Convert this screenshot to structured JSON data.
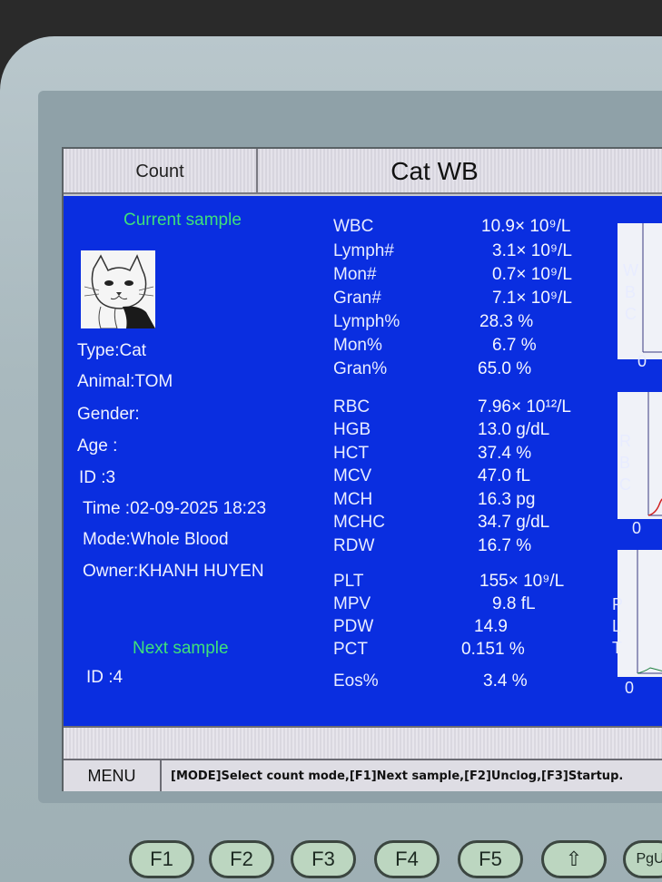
{
  "header": {
    "mode_label": "Count",
    "title": "Cat WB"
  },
  "current": {
    "heading": "Current sample",
    "type": "Type:Cat",
    "animal": "Animal:TOM",
    "gender": "Gender:",
    "age": "Age  :",
    "id": "ID    :3",
    "time": "Time :02-09-2025 18:23",
    "mode": "Mode:Whole Blood",
    "owner": "Owner:KHANH HUYEN"
  },
  "next": {
    "heading": "Next sample",
    "id": "ID    :4"
  },
  "parameters": [
    {
      "name": "WBC",
      "value": "10.9× 10⁹/L"
    },
    {
      "name": "Lymph#",
      "value": "3.1× 10⁹/L"
    },
    {
      "name": "Mon#",
      "value": "0.7× 10⁹/L"
    },
    {
      "name": "Gran#",
      "value": "7.1× 10⁹/L"
    },
    {
      "name": "Lymph%",
      "value": "28.3 %"
    },
    {
      "name": "Mon%",
      "value": "6.7 %"
    },
    {
      "name": "Gran%",
      "value": "65.0 %"
    },
    {
      "name": "RBC",
      "value": "7.96× 10¹²/L"
    },
    {
      "name": "HGB",
      "value": "13.0 g/dL"
    },
    {
      "name": "HCT",
      "value": "37.4 %"
    },
    {
      "name": "MCV",
      "value": "47.0 fL"
    },
    {
      "name": "MCH",
      "value": "16.3 pg"
    },
    {
      "name": "MCHC",
      "value": "34.7 g/dL"
    },
    {
      "name": "RDW",
      "value": "16.7 %"
    },
    {
      "name": "PLT",
      "value": "155× 10⁹/L"
    },
    {
      "name": "MPV",
      "value": "9.8 fL"
    },
    {
      "name": "PDW",
      "value": "14.9"
    },
    {
      "name": "PCT",
      "value": "0.151 %"
    },
    {
      "name": "Eos%",
      "value": "3.4 %"
    }
  ],
  "histograms": {
    "wbc": {
      "letters": [
        "W",
        "B",
        "C"
      ],
      "zero": "0"
    },
    "rbc": {
      "letters": [
        "R",
        "B",
        "C"
      ],
      "zero": "0"
    },
    "plt": {
      "letters": [
        "P",
        "L",
        "T"
      ],
      "zero": "0"
    }
  },
  "statusbar": {
    "menu": "MENU",
    "message": "[MODE]Select count mode,[F1]Next sample,[F2]Unclog,[F3]Startup."
  },
  "keys": [
    "F1",
    "F2",
    "F3",
    "F4",
    "F5",
    "⇧",
    "PgU"
  ]
}
